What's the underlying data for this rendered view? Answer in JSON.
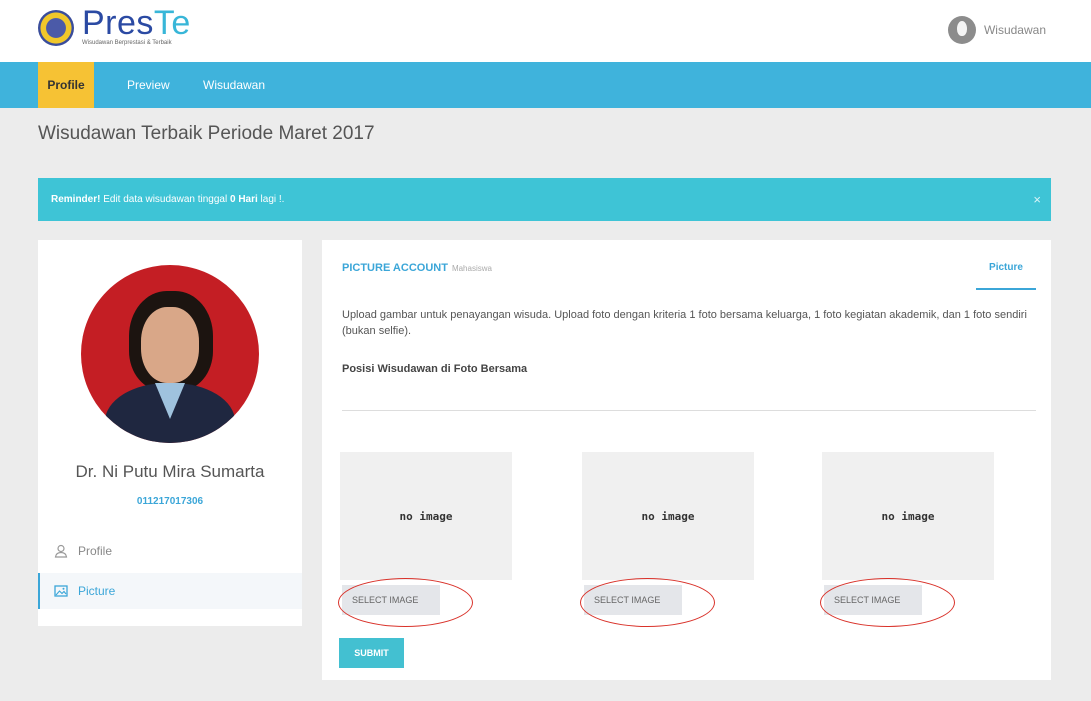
{
  "header": {
    "logo_part1": "Pres",
    "logo_part2": "Te",
    "logo_tagline": "Wisudawan Berprestasi & Terbaik",
    "user_label": "Wisudawan"
  },
  "nav": {
    "items": [
      {
        "label": "Profile",
        "active": true
      },
      {
        "label": "Preview",
        "active": false
      },
      {
        "label": "Wisudawan",
        "active": false
      }
    ]
  },
  "page": {
    "title": "Wisudawan Terbaik Periode Maret 2017"
  },
  "reminder": {
    "strong": "Reminder!",
    "text_before": " Edit data wisudawan tinggal ",
    "days": "0 Hari",
    "text_after": " lagi !.",
    "close": "×"
  },
  "profile": {
    "name": "Dr. Ni Putu Mira Sumarta",
    "nim": "011217017306",
    "menu": [
      {
        "label": "Profile",
        "icon": "user-icon",
        "active": false
      },
      {
        "label": "Picture",
        "icon": "image-icon",
        "active": true
      }
    ]
  },
  "picture_account": {
    "heading": "PICTURE ACCOUNT",
    "subheading": "Mahasiswa",
    "tab": "Picture",
    "description": "Upload gambar untuk penayangan wisuda. Upload foto dengan kriteria 1 foto bersama keluarga, 1 foto kegiatan akademik, dan 1 foto sendiri (bukan selfie).",
    "label": "Posisi Wisudawan di Foto Bersama",
    "slots": [
      {
        "placeholder": "no image",
        "button": "SELECT IMAGE"
      },
      {
        "placeholder": "no image",
        "button": "SELECT IMAGE"
      },
      {
        "placeholder": "no image",
        "button": "SELECT IMAGE"
      }
    ],
    "submit": "SUBMIT"
  },
  "colors": {
    "nav_bg": "#3fb3dc",
    "nav_active": "#f6c234",
    "reminder_bg": "#3ec4d6",
    "accent": "#3ba6d8",
    "annotation": "#d9322a"
  }
}
